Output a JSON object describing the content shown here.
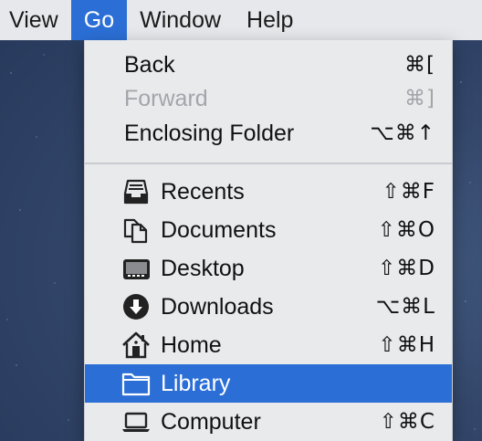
{
  "menubar": {
    "items": [
      {
        "label": "View"
      },
      {
        "label": "Go"
      },
      {
        "label": "Window"
      },
      {
        "label": "Help"
      }
    ]
  },
  "go_menu": {
    "items": [
      {
        "label": "Back",
        "shortcut": "⌘[",
        "enabled": true
      },
      {
        "label": "Forward",
        "shortcut": "⌘]",
        "enabled": false
      },
      {
        "label": "Enclosing Folder",
        "shortcut": "⌥⌘↑",
        "enabled": true
      },
      {
        "label": "Recents",
        "shortcut": "⇧⌘F",
        "icon": "recents-icon"
      },
      {
        "label": "Documents",
        "shortcut": "⇧⌘O",
        "icon": "documents-icon"
      },
      {
        "label": "Desktop",
        "shortcut": "⇧⌘D",
        "icon": "desktop-icon"
      },
      {
        "label": "Downloads",
        "shortcut": "⌥⌘L",
        "icon": "downloads-icon"
      },
      {
        "label": "Home",
        "shortcut": "⇧⌘H",
        "icon": "home-icon"
      },
      {
        "label": "Library",
        "shortcut": "",
        "icon": "folder-icon",
        "highlighted": true
      },
      {
        "label": "Computer",
        "shortcut": "⇧⌘C",
        "icon": "computer-icon"
      }
    ]
  },
  "colors": {
    "highlight": "#2b6fd6",
    "menu_background": "#e9eaec",
    "menubar_background": "#e6e8ec",
    "disabled_text": "#a3a5aa"
  }
}
